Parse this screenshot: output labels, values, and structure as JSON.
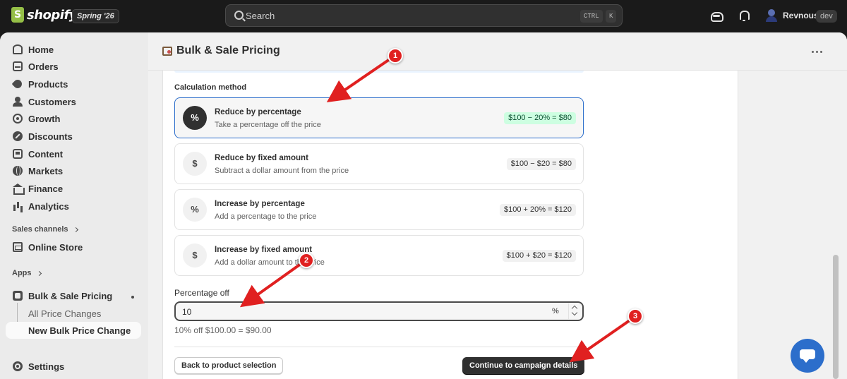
{
  "topbar": {
    "logo_text": "shopify",
    "edition": "Spring '26",
    "search_placeholder": "Search",
    "shortcut_ctrl": "CTRL",
    "shortcut_k": "K",
    "store_name": "Revnous",
    "store_badge": "dev"
  },
  "sidebar": {
    "items": [
      {
        "label": "Home",
        "icon": "home-icon"
      },
      {
        "label": "Orders",
        "icon": "orders-icon"
      },
      {
        "label": "Products",
        "icon": "tag-icon"
      },
      {
        "label": "Customers",
        "icon": "person-icon"
      },
      {
        "label": "Growth",
        "icon": "growth-icon"
      },
      {
        "label": "Discounts",
        "icon": "discount-icon"
      },
      {
        "label": "Content",
        "icon": "content-icon"
      },
      {
        "label": "Markets",
        "icon": "globe-icon"
      },
      {
        "label": "Finance",
        "icon": "bank-icon"
      },
      {
        "label": "Analytics",
        "icon": "bar-chart-icon"
      }
    ],
    "sales_channels_label": "Sales channels",
    "online_store_label": "Online Store",
    "apps_label": "Apps",
    "app_name": "Bulk & Sale Pricing",
    "app_sub_items": [
      "All Price Changes",
      "New Bulk Price Change"
    ],
    "settings_label": "Settings"
  },
  "page": {
    "title": "Bulk & Sale Pricing",
    "section_label": "Calculation method",
    "methods": [
      {
        "symbol": "%",
        "title": "Reduce by percentage",
        "desc": "Take a percentage off the price",
        "example": "$100 − 20% = $80",
        "selected": true
      },
      {
        "symbol": "$",
        "title": "Reduce by fixed amount",
        "desc": "Subtract a dollar amount from the price",
        "example": "$100 − $20 = $80",
        "selected": false
      },
      {
        "symbol": "%",
        "title": "Increase by percentage",
        "desc": "Add a percentage to the price",
        "example": "$100 + 20% = $120",
        "selected": false
      },
      {
        "symbol": "$",
        "title": "Increase by fixed amount",
        "desc": "Add a dollar amount to the price",
        "example": "$100 + $20 = $120",
        "selected": false
      }
    ],
    "field_label": "Percentage off",
    "field_value": "10",
    "field_suffix": "%",
    "help_text": "10% off $100.00 = $90.00",
    "back_button": "Back to product selection",
    "continue_button": "Continue to campaign details"
  },
  "annotations": [
    "1",
    "2",
    "3"
  ],
  "colors": {
    "accent": "#2c6ecb",
    "selected_badge_bg": "#cdfee1",
    "annotation_red": "#e02020",
    "primary_button": "#303030"
  }
}
